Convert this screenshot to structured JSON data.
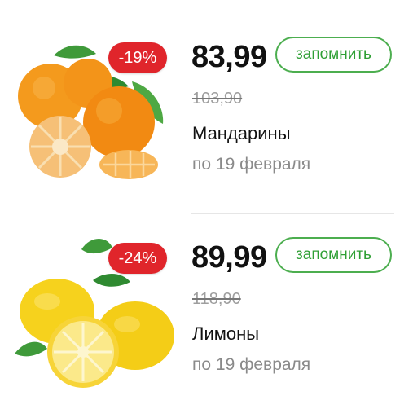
{
  "offers": [
    {
      "discount": "-19%",
      "price": "83,99",
      "old_price": "103,90",
      "name": "Мандарины",
      "valid_until": "по 19 февраля",
      "button_label": "запомнить",
      "image_icon": "tangerines-image"
    },
    {
      "discount": "-24%",
      "price": "89,99",
      "old_price": "118,90",
      "name": "Лимоны",
      "valid_until": "по 19 февраля",
      "button_label": "запомнить",
      "image_icon": "lemons-image"
    }
  ],
  "colors": {
    "badge": "#e0252b",
    "button_border": "#4cae4f",
    "button_text": "#2e9f34"
  }
}
